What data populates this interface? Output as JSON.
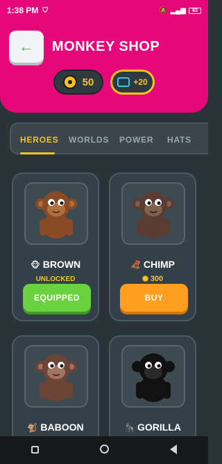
{
  "status_bar": {
    "time": "1:38 PM",
    "battery": "83"
  },
  "header": {
    "title": "MONKEY SHOP",
    "coins": "50",
    "ad_reward": "+20"
  },
  "tabs": [
    {
      "label": "HEROES",
      "active": true
    },
    {
      "label": "WORLDS",
      "active": false
    },
    {
      "label": "POWER",
      "active": false
    },
    {
      "label": "HATS",
      "active": false
    }
  ],
  "cards": [
    {
      "name": "BROWN",
      "emoji": "🐵",
      "status": "UNLOCKED",
      "button": "EQUIPPED",
      "body_color": "#8a4a26",
      "face_color": "#b0703e"
    },
    {
      "name": "CHIMP",
      "emoji": "🦧",
      "price": "300",
      "button": "BUY",
      "body_color": "#5a3c33",
      "face_color": "#80604e"
    },
    {
      "name": "BABOON",
      "emoji": "🐒",
      "body_color": "#6b4436",
      "face_color": "#a27262"
    },
    {
      "name": "GORILLA",
      "emoji": "🦍",
      "body_color": "#111111",
      "face_color": "#2a2a2a"
    }
  ]
}
